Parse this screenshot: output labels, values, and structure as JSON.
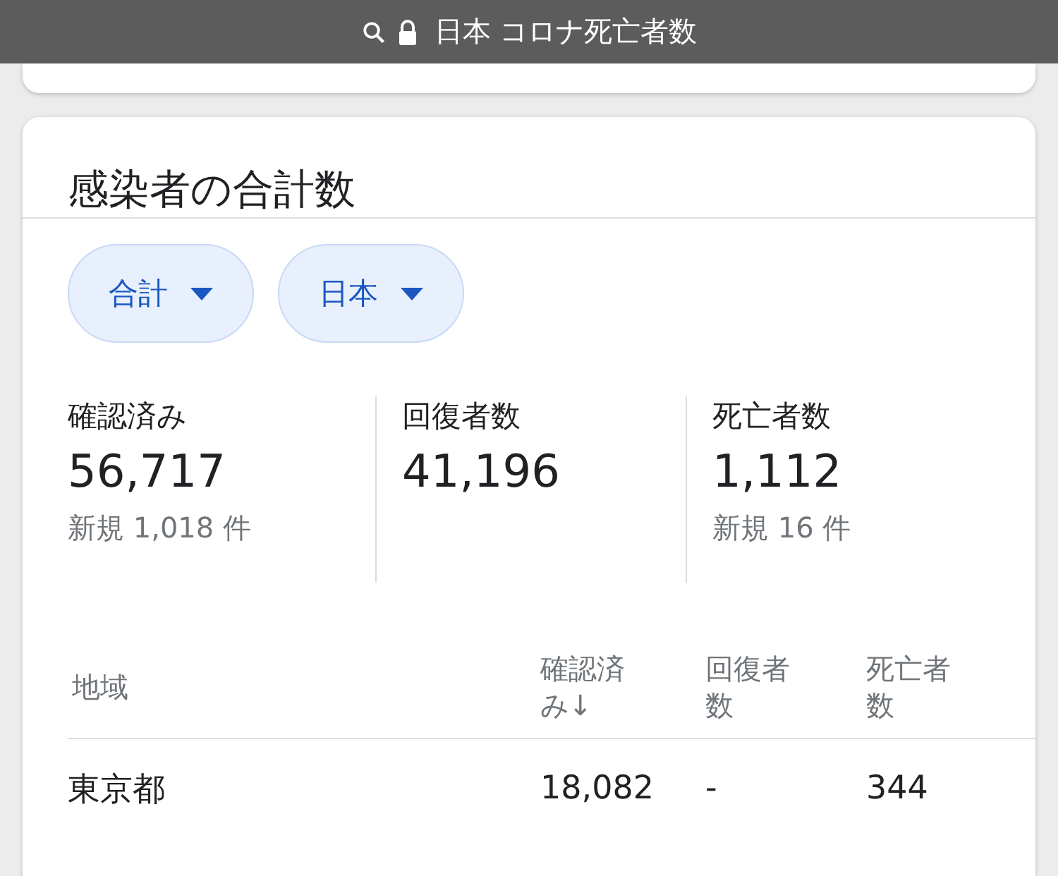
{
  "address_bar": {
    "text": "日本 コロナ死亡者数"
  },
  "card": {
    "title": "感染者の合計数",
    "filters": [
      {
        "label": "合計"
      },
      {
        "label": "日本"
      }
    ],
    "stats": [
      {
        "label": "確認済み",
        "value": "56,717",
        "note": "新規 1,018 件"
      },
      {
        "label": "回復者数",
        "value": "41,196"
      },
      {
        "label": "死亡者数",
        "value": "1,112",
        "note": "新規 16 件"
      }
    ],
    "table": {
      "columns": [
        "地域",
        "確認済み↓",
        "回復者数",
        "死亡者数"
      ],
      "rows": [
        [
          "東京都",
          "18,082",
          "-",
          "344"
        ]
      ]
    }
  }
}
